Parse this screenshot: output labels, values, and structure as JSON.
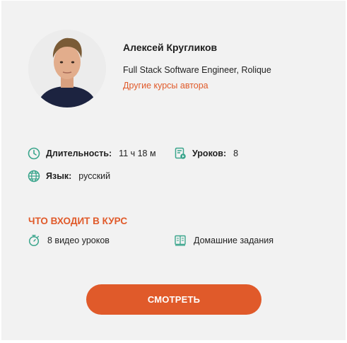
{
  "author": {
    "name": "Алексей Кругликов",
    "role": "Full Stack Software Engineer, Rolique",
    "other_courses_link": "Другие курсы автора",
    "avatar_icon": "author-photo"
  },
  "course_info": {
    "duration_label": "Длительность:",
    "duration_value": "11 ч 18 м",
    "lessons_label": "Уроков:",
    "lessons_value": "8",
    "language_label": "Язык:",
    "language_value": "русский"
  },
  "includes": {
    "title": "ЧТО ВХОДИТ В КУРС",
    "items": [
      {
        "icon": "stopwatch-icon",
        "label": "8 видео уроков"
      },
      {
        "icon": "homework-book-icon",
        "label": "Домашние задания"
      }
    ]
  },
  "cta": {
    "label": "СМОТРЕТЬ"
  },
  "colors": {
    "accent": "#e05a2a",
    "icon_teal": "#3aa58c",
    "card_bg": "#f2f2f2"
  }
}
